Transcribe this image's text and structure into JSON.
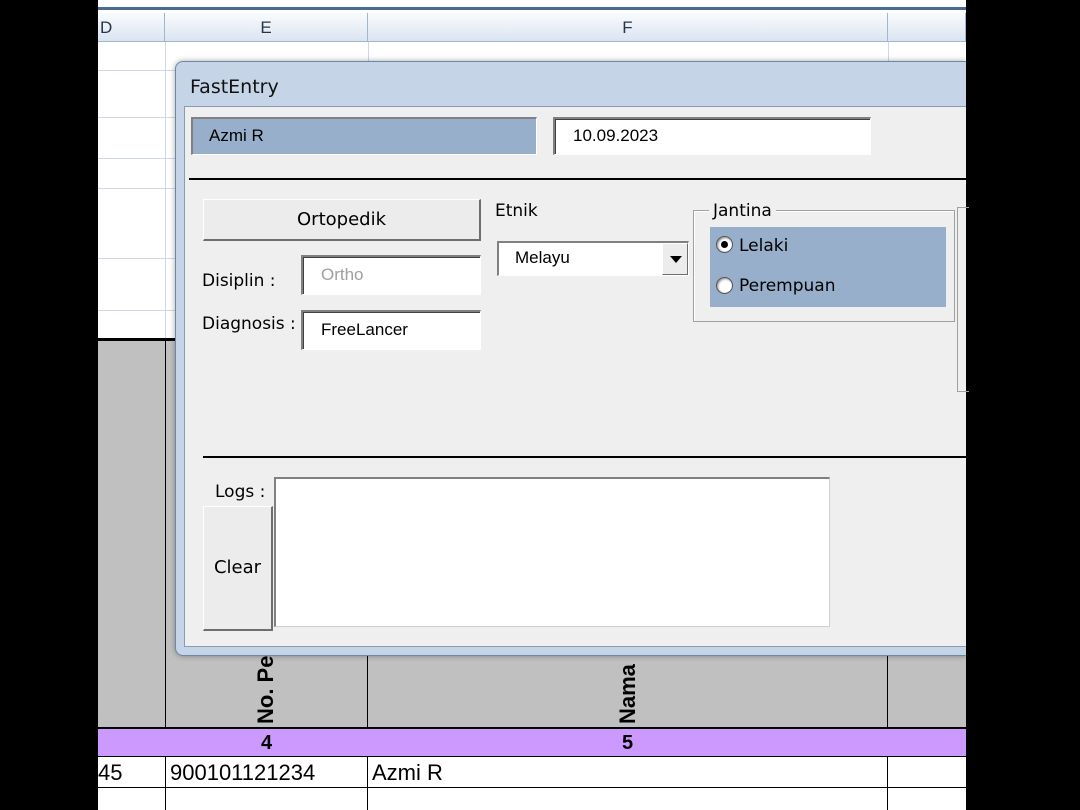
{
  "sheet": {
    "columns": [
      {
        "label": "D"
      },
      {
        "label": "E"
      },
      {
        "label": "F"
      }
    ],
    "vertical_headers": {
      "col_e": "No. Pe",
      "col_f": "Nama"
    },
    "number_row": {
      "col_e": "4",
      "col_f": "5"
    },
    "data_row": {
      "col_d": "45",
      "col_e": "900101121234",
      "col_f": "Azmi R"
    },
    "colors": {
      "header_band": "#cc99ff",
      "gray_block": "#c0c0c0"
    }
  },
  "dialog": {
    "title": "FastEntry",
    "name_value": "Azmi R",
    "date_value": "10.09.2023",
    "ortopedik_button": "Ortopedik",
    "disiplin_label": "Disiplin :",
    "disiplin_value": "Ortho",
    "diagnosis_label": "Diagnosis :",
    "diagnosis_value": "FreeLancer",
    "etnik_label": "Etnik",
    "etnik_value": "Melayu",
    "jantina_label": "Jantina",
    "jantina_options": [
      {
        "label": "Lelaki",
        "selected": true
      },
      {
        "label": "Perempuan",
        "selected": false
      }
    ],
    "logs_label": "Logs :",
    "logs_value": "",
    "clear_button": "Clear",
    "colors": {
      "selection_blue": "#98afcb",
      "window_frame": "#c5d4e6"
    }
  }
}
